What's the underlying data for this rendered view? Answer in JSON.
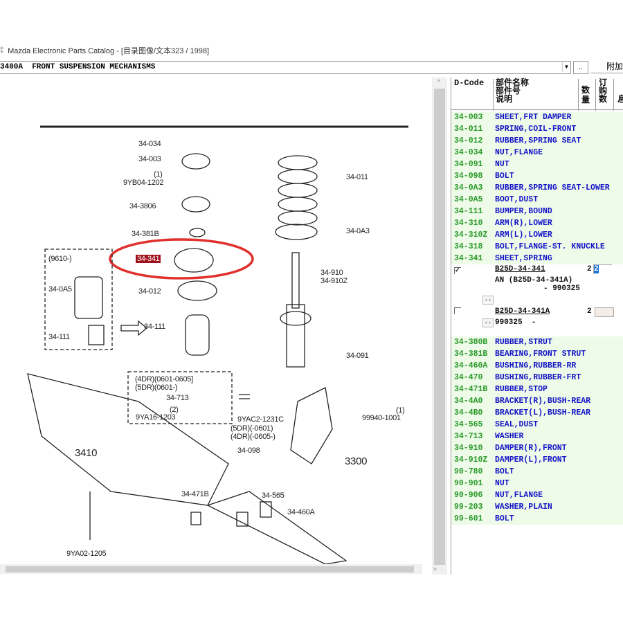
{
  "window": {
    "title": "Mazda Electronic Parts Catalog - [目录图像/文本323 / 1998]"
  },
  "toolbar": {
    "group_select": "3400A  FRONT SUSPENSION MECHANISMS",
    "browse_label": "..",
    "attach_label": "附加"
  },
  "diagram": {
    "highlighted": "34-341",
    "labels": [
      "34-034",
      "34-003",
      "(1)",
      "9YB04-1202",
      "34-3806",
      "34-381B",
      "34-341",
      "34-012",
      "34-111",
      "(9610-)",
      "34-0A5",
      "34-111",
      "34-011",
      "34-0A3",
      "34-910",
      "34-910Z",
      "34-091",
      "(4DR)(0601-0605]",
      "(5DR)(0601-)",
      "34-713",
      "(2)",
      "9YA16-1203",
      "9YAC2-1231C",
      "(5DR)(-0601)",
      "(4DR)(-0605-)",
      "(1)",
      "99940-1001",
      "34-098",
      "3410",
      "3300",
      "34-471B",
      "34-565",
      "34-460A",
      "9YA02-1205"
    ]
  },
  "table": {
    "headers": {
      "dcode": "D-Code",
      "name": "部件名称",
      "partno": "部件号",
      "desc": "说明",
      "qty": "数量",
      "order": "订购数",
      "info": "息"
    },
    "rows_top": [
      {
        "code": "34-003",
        "name": "SHEET,FRT DAMPER"
      },
      {
        "code": "34-011",
        "name": "SPRING,COIL-FRONT"
      },
      {
        "code": "34-012",
        "name": "RUBBER,SPRING SEAT"
      },
      {
        "code": "34-034",
        "name": "NUT,FLANGE"
      },
      {
        "code": "34-091",
        "name": "NUT"
      },
      {
        "code": "34-098",
        "name": "BOLT"
      },
      {
        "code": "34-0A3",
        "name": "RUBBER,SPRING SEAT-LOWER"
      },
      {
        "code": "34-0A5",
        "name": "BOOT,DUST"
      },
      {
        "code": "34-111",
        "name": "BUMPER,BOUND"
      },
      {
        "code": "34-310",
        "name": "ARM(R),LOWER"
      },
      {
        "code": "34-310Z",
        "name": "ARM(L),LOWER"
      },
      {
        "code": "34-318",
        "name": "BOLT,FLANGE-ST. KNUCKLE"
      },
      {
        "code": "34-341",
        "name": "SHEET,SPRING"
      }
    ],
    "parts": [
      {
        "checked": true,
        "part_no": "B25D-34-341",
        "qty": "2",
        "order": "2",
        "note1": "AN (B25D-34-341A)",
        "note2": "- 990325",
        "more": ".."
      },
      {
        "checked": false,
        "part_no": "B25D-34-341A",
        "qty": "2",
        "order": "",
        "note1": "990325  -",
        "more": ".."
      }
    ],
    "rows_bottom": [
      {
        "code": "34-380B",
        "name": "RUBBER,STRUT"
      },
      {
        "code": "34-381B",
        "name": "BEARING,FRONT STRUT"
      },
      {
        "code": "34-460A",
        "name": "BUSHING,RUBBER-RR"
      },
      {
        "code": "34-470",
        "name": "BUSHING,RUBBER-FRT"
      },
      {
        "code": "34-471B",
        "name": "RUBBER,STOP"
      },
      {
        "code": "34-4A0",
        "name": "BRACKET(R),BUSH-REAR"
      },
      {
        "code": "34-4B0",
        "name": "BRACKET(L),BUSH-REAR"
      },
      {
        "code": "34-565",
        "name": "SEAL,DUST"
      },
      {
        "code": "34-713",
        "name": "WASHER"
      },
      {
        "code": "34-910",
        "name": "DAMPER(R),FRONT"
      },
      {
        "code": "34-910Z",
        "name": "DAMPER(L),FRONT"
      },
      {
        "code": "90-780",
        "name": "BOLT"
      },
      {
        "code": "90-901",
        "name": "NUT"
      },
      {
        "code": "90-906",
        "name": "NUT,FLANGE"
      },
      {
        "code": "99-203",
        "name": "WASHER,PLAIN"
      },
      {
        "code": "99-601",
        "name": "BOLT"
      }
    ]
  }
}
